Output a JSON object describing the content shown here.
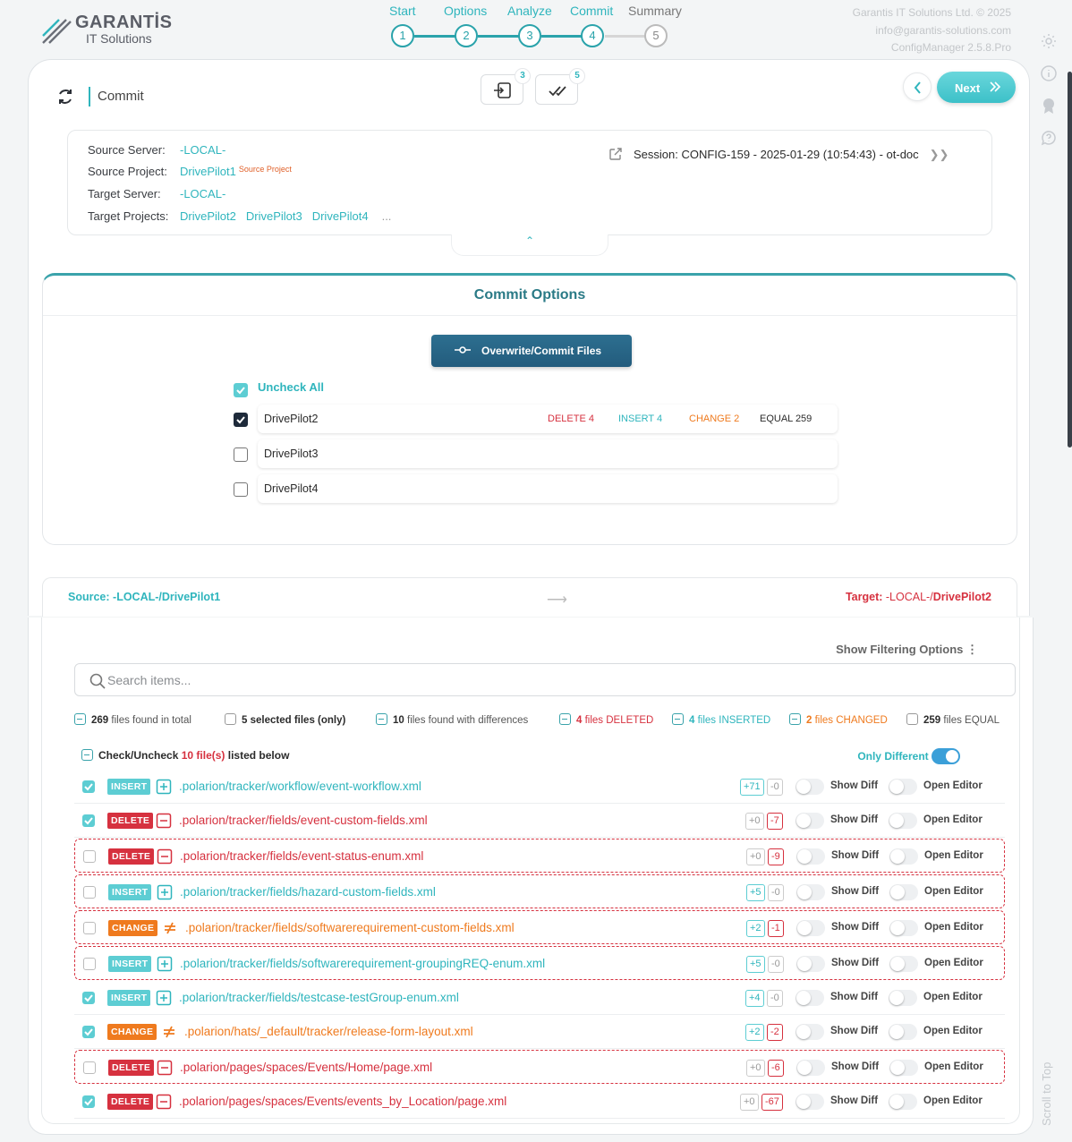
{
  "header": {
    "brand": "GARANTİS",
    "brand_sub": "IT Solutions",
    "company_line1": "Garantis IT Solutions Ltd. © 2025",
    "company_line2": "info@garantis-solutions.com",
    "company_line3": "ConfigManager 2.5.8.Pro",
    "steps": [
      {
        "label": "Start",
        "number": "1"
      },
      {
        "label": "Options",
        "number": "2"
      },
      {
        "label": "Analyze",
        "number": "3"
      },
      {
        "label": "Commit",
        "number": "4"
      },
      {
        "label": "Summary",
        "number": "5"
      }
    ],
    "active_step": 4
  },
  "toolbar": {
    "title": "Commit",
    "import_badge": "3",
    "check_badge": "5",
    "next_label": "Next"
  },
  "info": {
    "source_server_label": "Source Server:",
    "source_server": "-LOCAL-",
    "source_project_label": "Source Project:",
    "source_project": "DrivePilot1",
    "source_project_badge": "Source Project",
    "target_server_label": "Target Server:",
    "target_server": "-LOCAL-",
    "target_projects_label": "Target Projects:",
    "target_projects": [
      "DrivePilot2",
      "DrivePilot3",
      "DrivePilot4"
    ],
    "target_more": "...",
    "session": "Session: CONFIG-159 - 2025-01-29 (10:54:43) - ot-doc"
  },
  "commit_options": {
    "heading": "Commit Options",
    "overwrite_label": "Overwrite/Commit Files",
    "uncheck_all": "Uncheck All",
    "targets": [
      {
        "name": "DrivePilot2",
        "checked": true,
        "delete": "DELETE 4",
        "insert": "INSERT 4",
        "change": "CHANGE 2",
        "equal": "EQUAL 259"
      },
      {
        "name": "DrivePilot3",
        "checked": false
      },
      {
        "name": "DrivePilot4",
        "checked": false
      }
    ]
  },
  "source_target": {
    "source_label": "Source:",
    "source_value": "-LOCAL-/DrivePilot1",
    "target_label": "Target:",
    "target_value_prefix": "-LOCAL-/",
    "target_value_project": "DrivePilot2"
  },
  "files": {
    "filter_link": "Show Filtering Options",
    "search_placeholder": "Search items...",
    "stats": {
      "total_num": "269",
      "total_text": "files found in total",
      "selected_num": "5",
      "selected_text": "selected files (only)",
      "diff_num": "10",
      "diff_text": "files found with differences",
      "deleted_num": "4",
      "deleted_text": "files DELETED",
      "inserted_num": "4",
      "inserted_text": "files INSERTED",
      "changed_num": "2",
      "changed_text": "files CHANGED",
      "equal_num": "259",
      "equal_text": "files EQUAL"
    },
    "check_all_prefix": "Check/Uncheck",
    "check_all_count": "10 file(s)",
    "check_all_suffix": "listed below",
    "only_different": "Only Different",
    "show_diff": "Show Diff",
    "open_editor": "Open Editor",
    "rows": [
      {
        "checked": true,
        "type": "INSERT",
        "path": ".polarion/tracker/workflow/event-workflow.xml",
        "plus": "+71",
        "minus": "-0"
      },
      {
        "checked": true,
        "type": "DELETE",
        "path": ".polarion/tracker/fields/event-custom-fields.xml",
        "plus": "+0",
        "minus": "-7"
      },
      {
        "checked": false,
        "type": "DELETE",
        "path": ".polarion/tracker/fields/event-status-enum.xml",
        "plus": "+0",
        "minus": "-9"
      },
      {
        "checked": false,
        "type": "INSERT",
        "path": ".polarion/tracker/fields/hazard-custom-fields.xml",
        "plus": "+5",
        "minus": "-0"
      },
      {
        "checked": false,
        "type": "CHANGE",
        "path": ".polarion/tracker/fields/softwarerequirement-custom-fields.xml",
        "plus": "+2",
        "minus": "-1"
      },
      {
        "checked": false,
        "type": "INSERT",
        "path": ".polarion/tracker/fields/softwarerequirement-groupingREQ-enum.xml",
        "plus": "+5",
        "minus": "-0"
      },
      {
        "checked": true,
        "type": "INSERT",
        "path": ".polarion/tracker/fields/testcase-testGroup-enum.xml",
        "plus": "+4",
        "minus": "-0"
      },
      {
        "checked": true,
        "type": "CHANGE",
        "path": ".polarion/hats/_default/tracker/release-form-layout.xml",
        "plus": "+2",
        "minus": "-2"
      },
      {
        "checked": false,
        "type": "DELETE",
        "path": ".polarion/pages/spaces/Events/Home/page.xml",
        "plus": "+0",
        "minus": "-6"
      },
      {
        "checked": true,
        "type": "DELETE",
        "path": ".polarion/pages/spaces/Events/events_by_Location/page.xml",
        "plus": "+0",
        "minus": "-67"
      }
    ]
  },
  "scroll_to_top": "Scroll to Top",
  "colors": {
    "teal": "#2fb5bd",
    "red": "#d6313f",
    "orange": "#ef7a1e",
    "navy": "#235c7d"
  }
}
